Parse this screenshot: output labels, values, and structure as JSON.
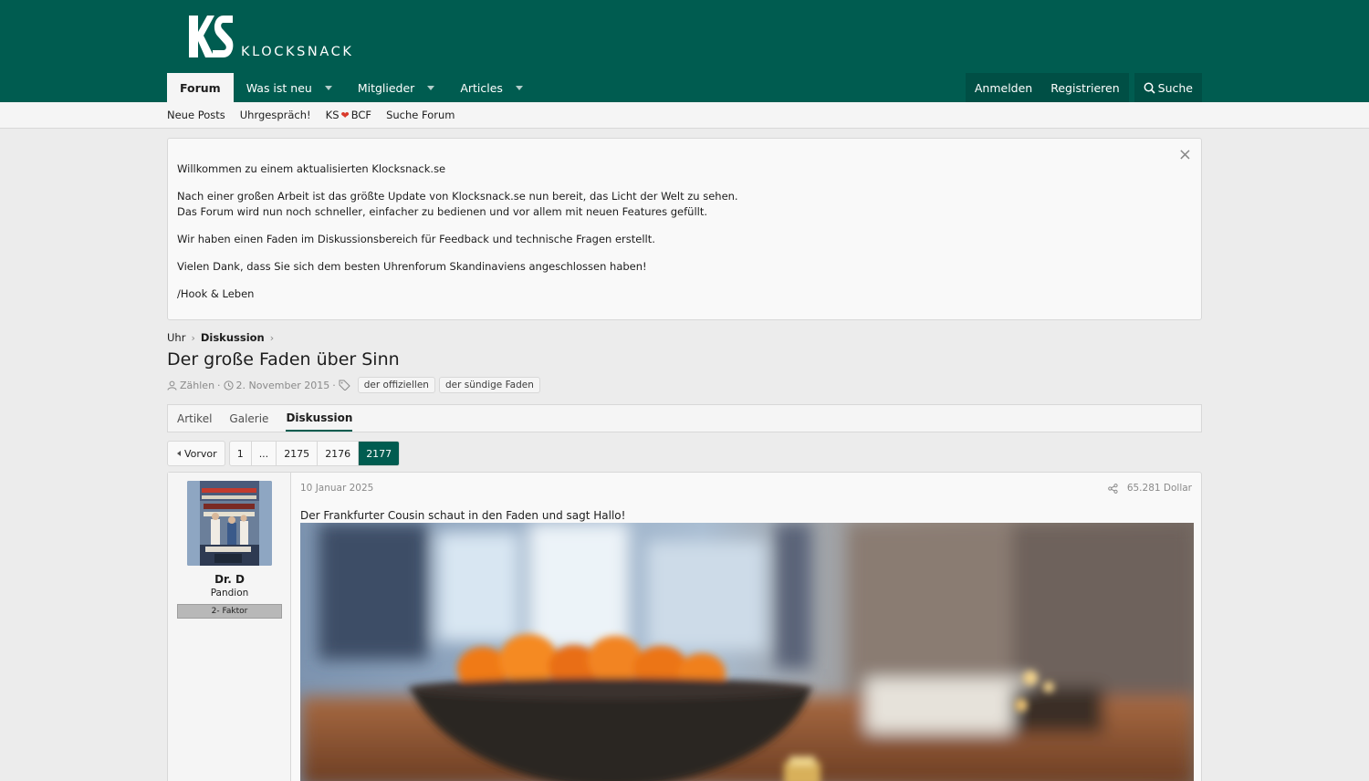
{
  "brand": {
    "name": "KLOCKSNACK",
    "logo": "ks-logo-mark"
  },
  "nav": {
    "tabs": [
      {
        "label": "Forum",
        "active": true
      },
      {
        "label": "Was ist neu",
        "dropdown": true
      },
      {
        "label": "Mitglieder",
        "dropdown": true
      },
      {
        "label": "Articles",
        "dropdown": true
      }
    ],
    "login": "Anmelden",
    "register": "Registrieren",
    "search": "Suche",
    "search_icon": "search-icon"
  },
  "subnav": {
    "items": [
      "Neue Posts",
      "Uhrgespräch!"
    ],
    "ks_left": "KS",
    "heart": "❤",
    "ks_right": "BCF",
    "search_forum": "Suche Forum"
  },
  "notice": {
    "line1": "Willkommen zu einem aktualisierten Klocksnack.se",
    "line2a": "Nach einer großen Arbeit ist das größte Update von Klocksnack.se nun bereit, das Licht der Welt zu sehen.",
    "line2b": "Das Forum wird nun noch schneller, einfacher zu bedienen und vor allem mit neuen Features gefüllt.",
    "line3": "Wir haben einen Faden im Diskussionsbereich für Feedback und technische Fragen erstellt.",
    "line4": "Vielen Dank, dass Sie sich dem besten Uhrenforum Skandinaviens angeschlossen haben!",
    "line5": "/Hook & Leben",
    "close": "×"
  },
  "breadcrumb": {
    "item1": "Uhr",
    "item2": "Diskussion"
  },
  "page": {
    "title": "Der große Faden über Sinn",
    "author": "Zählen",
    "date": "2. November 2015",
    "tags": [
      "der offiziellen",
      "der sündige Faden"
    ]
  },
  "content_tabs": [
    {
      "label": "Artikel"
    },
    {
      "label": "Galerie"
    },
    {
      "label": "Diskussion",
      "active": true
    }
  ],
  "pagination": {
    "prev": "Vorvor",
    "pages": [
      "1",
      "...",
      "2175",
      "2176",
      "2177"
    ],
    "current": "2177"
  },
  "post": {
    "date": "10 Januar 2025",
    "number": "65.281 Dollar",
    "text": "Der Frankfurter Cousin schaut in den Faden und sagt Hallo!",
    "user": {
      "name": "Dr. D",
      "title": "Pandion",
      "banner": "2- Faktor"
    }
  },
  "colors": {
    "brand_green": "#005c50",
    "background": "#ececec",
    "heart": "#d93a2b"
  }
}
